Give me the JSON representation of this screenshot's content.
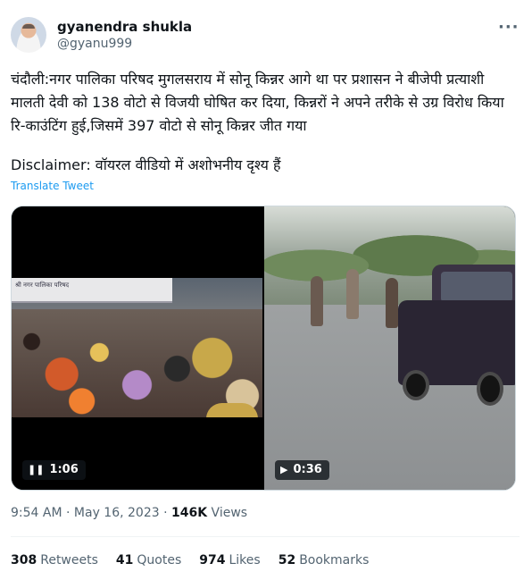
{
  "author": {
    "name": "gyanendra shukla",
    "handle": "@gyanu999"
  },
  "tweet": {
    "text": "चंदौली:नगर पालिका परिषद मुगलसराय में सोनू किन्नर आगे था पर प्रशासन ने बीजेपी प्रत्याशी मालती देवी को 138 वोटो से विजयी घोषित कर दिया, किन्नरों ने अपने तरीके से उग्र विरोध किया रि-काउंटिंग हुई,जिसमें 397 वोटो से सोनू किन्नर जीत  गया",
    "disclaimer": "Disclaimer: वॉयरल वीडियो में अशोभनीय दृश्य हैं",
    "translate_label": "Translate Tweet"
  },
  "media": [
    {
      "duration": "1:06",
      "icon": "pause-icon",
      "banner_text": "श्री नगर पालिका परिषद"
    },
    {
      "duration": "0:36",
      "icon": "play-icon"
    }
  ],
  "meta": {
    "time": "9:54 AM",
    "separator": "·",
    "date": "May 16, 2023",
    "views_count": "146K",
    "views_label": "Views"
  },
  "stats": [
    {
      "count": "308",
      "label": "Retweets"
    },
    {
      "count": "41",
      "label": "Quotes"
    },
    {
      "count": "974",
      "label": "Likes"
    },
    {
      "count": "52",
      "label": "Bookmarks"
    }
  ],
  "colors": {
    "accent": "#1d9bf0",
    "text": "#0f1419",
    "muted": "#536471"
  }
}
